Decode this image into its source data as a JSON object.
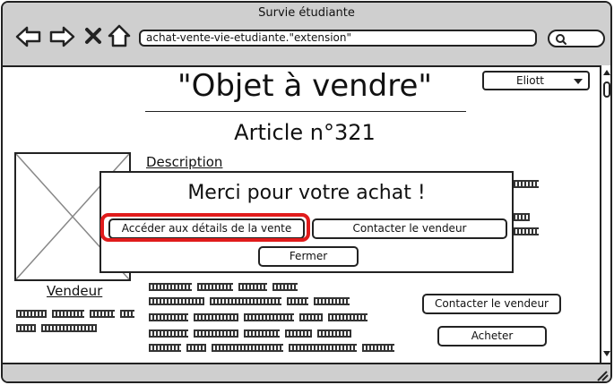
{
  "window": {
    "title": "Survie étudiante"
  },
  "nav": {
    "back_icon": "back-arrow-icon",
    "forward_icon": "forward-arrow-icon",
    "stop_icon": "close-icon",
    "home_icon": "home-icon"
  },
  "address_bar": {
    "value": "achat-vente-vie-etudiante.\"extension\""
  },
  "user_menu": {
    "selected": "Eliott"
  },
  "page": {
    "title": "\"Objet à vendre\"",
    "article": "Article n°321",
    "description_label": "Description",
    "seller_label": "Vendeur",
    "contact_seller": "Contacter le vendeur",
    "buy": "Acheter"
  },
  "modal": {
    "title": "Merci pour votre achat !",
    "details_button": "Accéder aux détails de la vente",
    "contact_button": "Contacter le vendeur",
    "close_button": "Fermer"
  },
  "colors": {
    "highlight": "#e01b1b",
    "chrome": "#cfcfcf"
  }
}
